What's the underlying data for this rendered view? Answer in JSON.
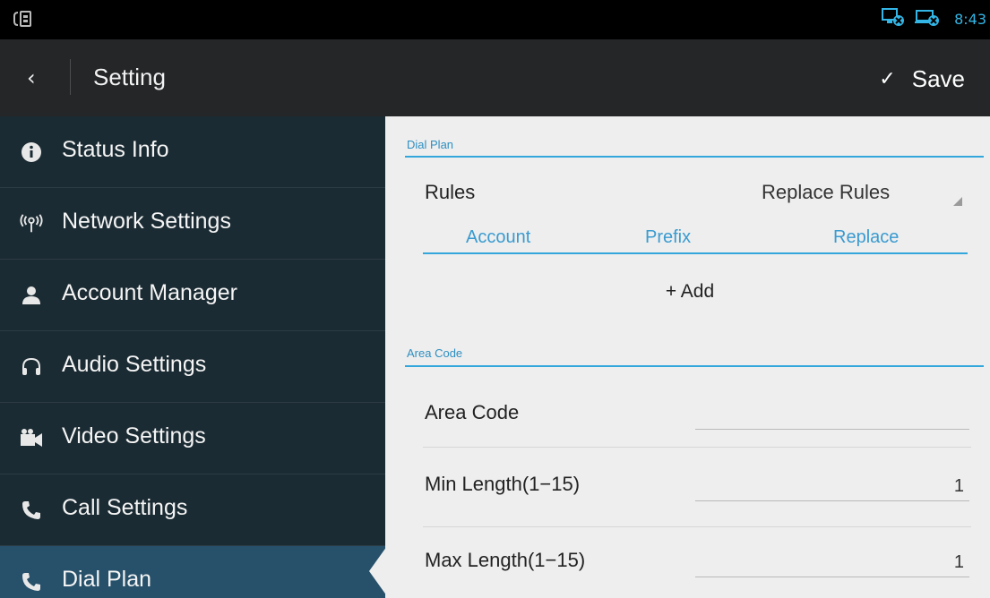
{
  "status_bar": {
    "left_icon": "sim-card-icon",
    "right_icons": [
      "network-disconnected-icon",
      "ethernet-disconnected-icon"
    ],
    "time": "8:43"
  },
  "action_bar": {
    "back_glyph": "‹",
    "title": "Setting",
    "save_check": "✓",
    "save_label": "Save"
  },
  "sidebar": {
    "items": [
      {
        "label": "Status Info",
        "icon": "info-icon"
      },
      {
        "label": "Network Settings",
        "icon": "network-icon"
      },
      {
        "label": "Account Manager",
        "icon": "person-icon"
      },
      {
        "label": "Audio Settings",
        "icon": "headset-icon"
      },
      {
        "label": "Video Settings",
        "icon": "video-camera-icon"
      },
      {
        "label": "Call Settings",
        "icon": "phone-icon"
      },
      {
        "label": "Dial Plan",
        "icon": "phone-icon",
        "selected": true
      }
    ]
  },
  "dial_plan": {
    "section_title": "Dial Plan",
    "rules_label": "Rules",
    "rules_value": "Replace Rules",
    "columns": [
      "Account",
      "Prefix",
      "Replace"
    ],
    "add_label": "+ Add"
  },
  "area_code": {
    "section_title": "Area Code",
    "fields": [
      {
        "label": "Area Code",
        "value": ""
      },
      {
        "label": "Min Length(1−15)",
        "value": "1"
      },
      {
        "label": "Max Length(1−15)",
        "value": "1"
      }
    ]
  },
  "colors": {
    "accent": "#33a7dc",
    "sidebar_bg": "#1b2b33",
    "sidebar_selected": "#27506a",
    "actionbar_bg": "#242628",
    "content_bg": "#eeeeee"
  }
}
